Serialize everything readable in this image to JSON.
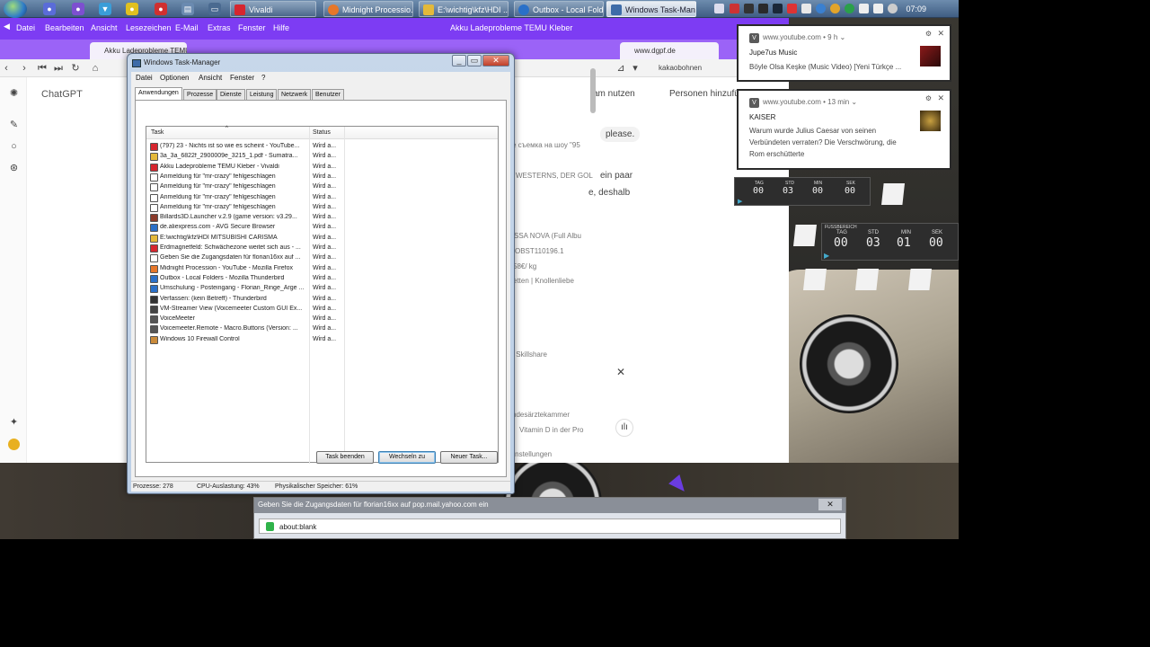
{
  "taskbar": {
    "tasks": [
      {
        "label": "Vivaldi",
        "color": "#d6262f"
      },
      {
        "label": "Midnight Processio...",
        "color": "#e6772a"
      },
      {
        "label": "E:\\wichtig\\kfz\\HDI ...",
        "color": "#e4b93a"
      },
      {
        "label": "Outbox - Local Fold...",
        "color": "#2a70c8"
      },
      {
        "label": "Windows Task-Man...",
        "color": "#3e6ca8"
      }
    ],
    "clock": "07:09"
  },
  "browser": {
    "title": "Akku Ladeprobleme TEMU Kleber",
    "menu": [
      "Datei",
      "Bearbeiten",
      "Ansicht",
      "Lesezeichen",
      "E-Mail",
      "Extras",
      "Fenster",
      "Hilfe"
    ],
    "tab_active": "Akku Ladeprobleme TEMU K",
    "tab_other": "www.dgpf.de",
    "search_text": "kakaobohnen",
    "app_label": "ChatGPT",
    "page_snippets": {
      "nutzen": "am nutzen",
      "personen": "Personen hinzufü",
      "please": "please.",
      "russian": "е съемка на шоу \"95",
      "ein_paar": "ein paar",
      "deshalb": "e, deshalb",
      "westerns": "WESTERNS, DER GOL",
      "bossa": "SSA NOVA (Full Albu",
      "obst": "OBST110196.1",
      "price": "58€/ kg",
      "knollen": "etten | Knollenliebe",
      "skillshare": "| Skillshare",
      "aerzte": "ndesärztekammer",
      "vitamin": "Vitamin D in der Pro",
      "einstellungen": "Einstellungen"
    }
  },
  "taskmanager": {
    "title": "Windows Task-Manager",
    "menu": [
      "Datei",
      "Optionen",
      "Ansicht",
      "Fenster",
      "?"
    ],
    "tabs": [
      "Anwendungen",
      "Prozesse",
      "Dienste",
      "Leistung",
      "Netzwerk",
      "Benutzer"
    ],
    "columns": {
      "task": "Task",
      "status": "Status"
    },
    "rows": [
      {
        "task": "(797) 23 - Nichts ist so wie es scheint - YouTube...",
        "status": "Wird a...",
        "color": "#d6262f"
      },
      {
        "task": "3a_3a_6822f_2900009e_3215_1.pdf - Sumatra...",
        "status": "Wird a...",
        "color": "#e4b93a"
      },
      {
        "task": "Akku Ladeprobleme TEMU Kleber - Vivaldi",
        "status": "Wird a...",
        "color": "#d6262f"
      },
      {
        "task": "Anmeldung für \"mr-crazy\" fehlgeschlagen",
        "status": "Wird a...",
        "color": "#ffffff"
      },
      {
        "task": "Anmeldung für \"mr-crazy\" fehlgeschlagen",
        "status": "Wird a...",
        "color": "#ffffff"
      },
      {
        "task": "Anmeldung für \"mr-crazy\" fehlgeschlagen",
        "status": "Wird a...",
        "color": "#ffffff"
      },
      {
        "task": "Anmeldung für \"mr-crazy\" fehlgeschlagen",
        "status": "Wird a...",
        "color": "#ffffff"
      },
      {
        "task": "Billards3D.Launcher v.2.9 (game version: v3.29...",
        "status": "Wird a...",
        "color": "#8a3a2a"
      },
      {
        "task": "de.aliexpress.com - AVG Secure Browser",
        "status": "Wird a...",
        "color": "#2a70c8"
      },
      {
        "task": "E:\\wichtig\\kfz\\HDI MITSUBISHI CARISMA",
        "status": "Wird a...",
        "color": "#e4b93a"
      },
      {
        "task": "Erdmagnetfeld: Schwächezone weitet sich aus - ...",
        "status": "Wird a...",
        "color": "#d6262f"
      },
      {
        "task": "Geben Sie die Zugangsdaten für florian16xx auf ...",
        "status": "Wird a...",
        "color": "#ffffff"
      },
      {
        "task": "Midnight Procession - YouTube - Mozilla Firefox",
        "status": "Wird a...",
        "color": "#e6772a"
      },
      {
        "task": "Outbox - Local Folders - Mozilla Thunderbird",
        "status": "Wird a...",
        "color": "#2a70c8"
      },
      {
        "task": "Umschulung - Posteingang - Florian_Ringe_Arge ...",
        "status": "Wird a...",
        "color": "#2a70c8"
      },
      {
        "task": "Verfassen: (kein Betreff) - Thunderbird",
        "status": "Wird a...",
        "color": "#333333"
      },
      {
        "task": "VM-Streamer View (Voicemeeter Custom GUI Ex...",
        "status": "Wird a...",
        "color": "#444444"
      },
      {
        "task": "VoiceMeeter",
        "status": "Wird a...",
        "color": "#555555"
      },
      {
        "task": "Voicemeeter.Remote - Macro.Buttons (Version: ...",
        "status": "Wird a...",
        "color": "#555555"
      },
      {
        "task": "Windows 10 Firewall Control",
        "status": "Wird a...",
        "color": "#c98a3a"
      }
    ],
    "buttons": {
      "end": "Task beenden",
      "switch": "Wechseln zu",
      "new": "Neuer Task..."
    },
    "status": {
      "processes": "Prozesse: 278",
      "cpu": "CPU-Auslastung: 43%",
      "memory": "Physikalischer Speicher: 61%"
    }
  },
  "notifications": [
    {
      "source": "www.youtube.com",
      "age": "9 h",
      "title": "Jupe7us Music",
      "body": "Böyle Olsa Keşke (Music Video) [Yeni Türkçe ..."
    },
    {
      "source": "www.youtube.com",
      "age": "13 min",
      "title": "KAISER",
      "body": "Warum wurde Julius Caesar von seinen Verbündeten verraten? Die Verschwörung, die Rom erschütterte"
    }
  ],
  "countdown": {
    "header": "FUSSBEREICH",
    "labels": [
      "TAG",
      "STD",
      "MIN",
      "SEK"
    ],
    "small_values": [
      "00",
      "03",
      "00",
      "00"
    ],
    "values": [
      "00",
      "03",
      "01",
      "00"
    ]
  },
  "password_prompt": {
    "title": "Geben Sie die Zugangsdaten für florian16xx auf pop.mail.yahoo.com ein",
    "url": "about:blank"
  }
}
